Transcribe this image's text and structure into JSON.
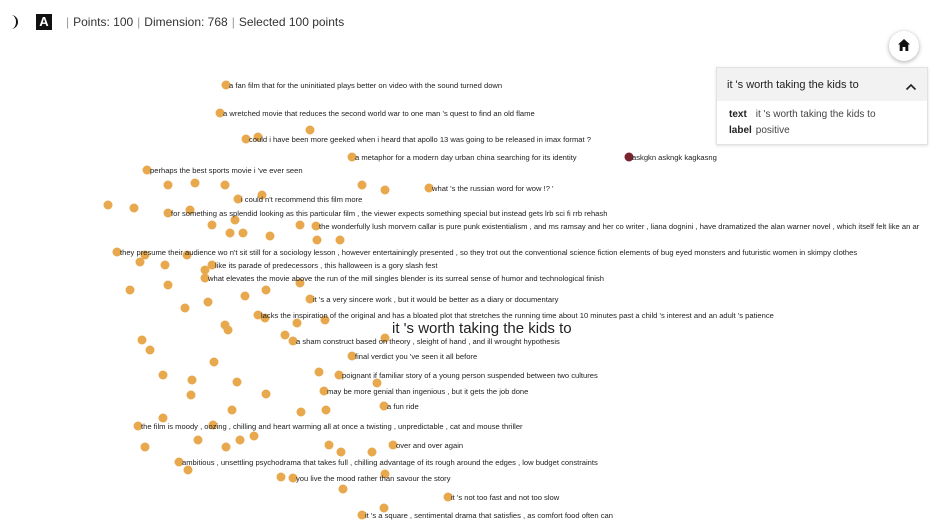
{
  "toolbar": {
    "theme_toggle_icon": "half-moon-icon",
    "label_toggle_icon": "letter-a-icon",
    "label_toggle_glyph": "A",
    "points": "Points: 100",
    "dimension": "Dimension: 768",
    "selected": "Selected 100 points",
    "home_icon": "home-icon"
  },
  "detail_card": {
    "title": "it 's worth taking the kids to",
    "fields": [
      {
        "key": "text",
        "value": "it 's worth taking the kids to"
      },
      {
        "key": "label",
        "value": "positive"
      }
    ],
    "collapse_icon": "chevron-up-icon"
  },
  "colors": {
    "point": "#e8a84e",
    "outlier_point": "#7a2430",
    "card_header": "#f2f2f2"
  },
  "highlighted_text": "it 's worth taking the kids to",
  "labeled_points": [
    "a fan film that for the uninitiated plays better on video with the sound turned down",
    "a wretched movie that reduces the second world war to one man 's quest to find an old flame",
    "could i have been more geeked when i heard that apollo 13 was going to be released in imax format ?",
    "a metaphor for a modern day urban china searching for its identity",
    "askgkn askngk kagkasng",
    "perhaps the best sports movie i 've ever seen",
    "what 's the russian word for wow !? '",
    "i could n't recommend this film more",
    "for something as splendid looking as this particular film , the viewer expects something special but instead gets lrb sci fi rrb rehash",
    "the wonderfully lush morvern callar is pure punk existentialism , and ms ramsay and her co writer , liana dognini , have dramatized the alan warner novel , which itself felt like an ar",
    "they presume their audience wo n't sit still for a sociology lesson , however entertainingly presented , so they trot out the conventional science fiction elements of bug eyed monsters and futuristic women in skimpy clothes",
    "like its parade of predecessors , this halloween is a gory slash fest",
    "what elevates the movie above the run of the mill singles blender is its surreal sense of humor and technological finish",
    "it 's a very sincere work , but it would be better as a diary or documentary",
    "lacks the inspiration of the original and has a bloated plot that stretches the running time about 10 minutes past a child 's interest and an adult 's patience",
    "a sham construct based on theory , sleight of hand , and ill wrought hypothesis",
    "final verdict you 've seen it all before",
    "poignant if familiar story of a young person suspended between two cultures",
    "may be more genial than ingenious , but it gets the job done",
    "a fun ride",
    "the film is moody , oozing , chilling and heart warming all at once a twisting , unpredictable , cat and mouse thriller",
    "over and over again",
    "ambitious , unsettling psychodrama that takes full , chilling advantage of its rough around the edges , low budget constraints",
    "you live the mood rather than savour the story",
    "it 's not too fast and not too slow",
    "it 's a square , sentimental drama that satisfies , as comfort food often can"
  ]
}
